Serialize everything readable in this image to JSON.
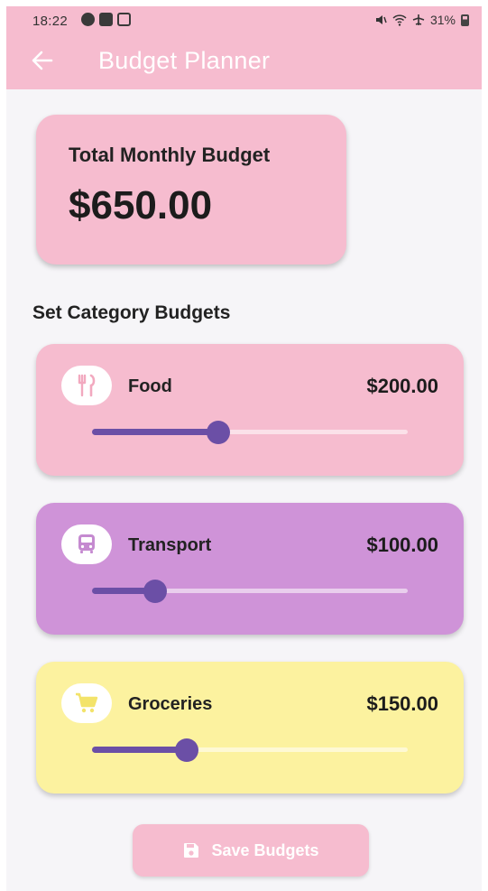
{
  "status_bar": {
    "time": "18:22",
    "battery": "31%"
  },
  "app_bar": {
    "title": "Budget Planner",
    "back_icon": "arrow-left-icon",
    "color": "#f6bccf"
  },
  "total": {
    "label": "Total Monthly Budget",
    "amount": "$650.00"
  },
  "section": {
    "title": "Set Category Budgets"
  },
  "categories": [
    {
      "name": "Food",
      "amount": "$200.00",
      "icon": "restaurant-icon",
      "color": "#f6bccf",
      "slider_fraction": 0.4
    },
    {
      "name": "Transport",
      "amount": "$100.00",
      "icon": "bus-icon",
      "color": "#cf93d8",
      "slider_fraction": 0.2
    },
    {
      "name": "Groceries",
      "amount": "$150.00",
      "icon": "cart-icon",
      "color": "#fcf29f",
      "slider_fraction": 0.3
    }
  ],
  "save_button": {
    "label": "Save Budgets",
    "icon": "save-icon"
  },
  "colors": {
    "accent": "#6b4fa6",
    "background": "#f6f5f8"
  }
}
